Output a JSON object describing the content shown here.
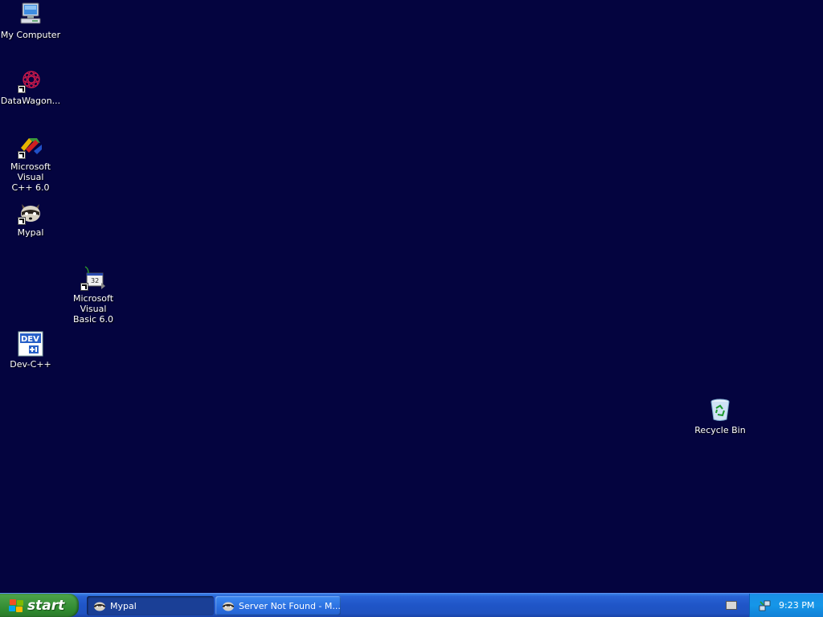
{
  "desktop": {
    "background": "#04043f",
    "icons": [
      {
        "label": "My Computer",
        "icon": "my-computer-icon"
      },
      {
        "label": "DataWagon...",
        "icon": "datawagon-icon"
      },
      {
        "label": "Microsoft Visual\nC++ 6.0",
        "icon": "visual-cpp-icon"
      },
      {
        "label": "Mypal",
        "icon": "mypal-icon"
      },
      {
        "label": "Microsoft Visual\nBasic 6.0",
        "icon": "visual-basic-icon"
      },
      {
        "label": "Dev-C++",
        "icon": "dev-cpp-icon"
      },
      {
        "label": "Recycle Bin",
        "icon": "recycle-bin-icon"
      }
    ]
  },
  "taskbar": {
    "start_label": "start",
    "tasks": [
      {
        "label": "Mypal",
        "icon": "mypal-icon",
        "active": true
      },
      {
        "label": "Server Not Found - M...",
        "icon": "mypal-icon",
        "active": false
      }
    ],
    "tray": {
      "clock": "9:23 PM",
      "icons": [
        "keyboard-icon",
        "network-icon"
      ]
    }
  }
}
